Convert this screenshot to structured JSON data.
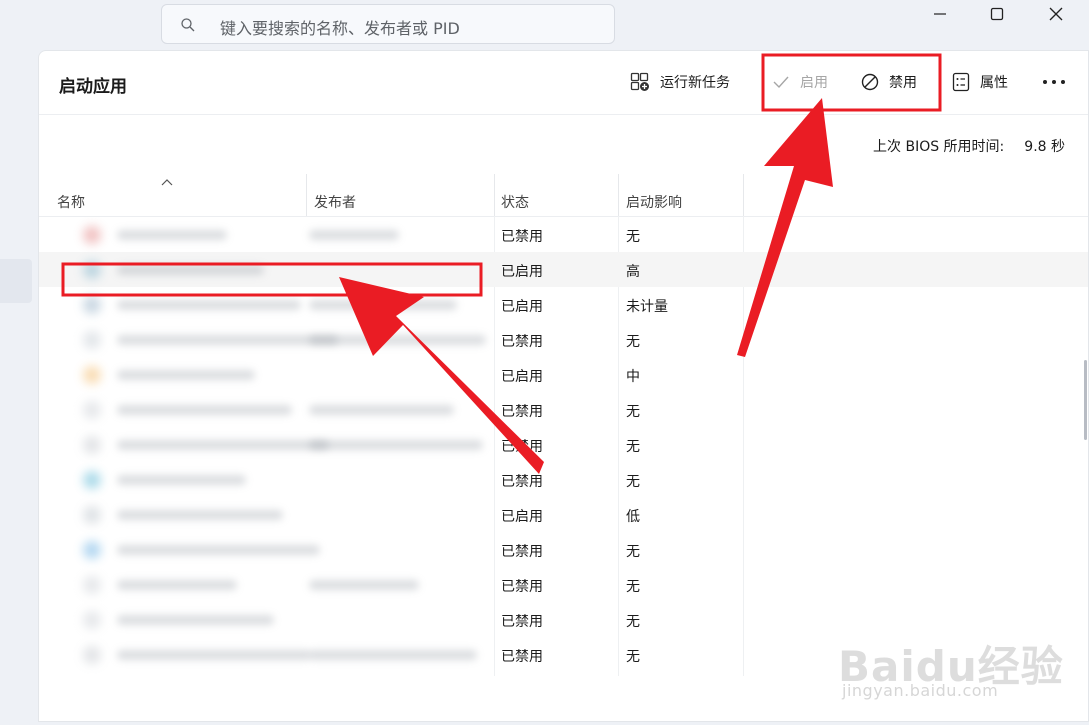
{
  "search": {
    "placeholder": "键入要搜索的名称、发布者或 PID"
  },
  "page": {
    "title": "启动应用"
  },
  "toolbar": {
    "run_new_task": "运行新任务",
    "enable": "启用",
    "disable": "禁用",
    "properties": "属性"
  },
  "bios": {
    "label": "上次 BIOS 所用时间:",
    "value": "9.8 秒"
  },
  "columns": {
    "name": "名称",
    "publisher": "发布者",
    "status": "状态",
    "impact": "启动影响"
  },
  "rows": [
    {
      "status": "已禁用",
      "impact": "无"
    },
    {
      "status": "已启用",
      "impact": "高"
    },
    {
      "status": "已启用",
      "impact": "未计量"
    },
    {
      "status": "已禁用",
      "impact": "无"
    },
    {
      "status": "已启用",
      "impact": "中"
    },
    {
      "status": "已禁用",
      "impact": "无"
    },
    {
      "status": "已禁用",
      "impact": "无"
    },
    {
      "status": "已禁用",
      "impact": "无"
    },
    {
      "status": "已启用",
      "impact": "低"
    },
    {
      "status": "已禁用",
      "impact": "无"
    },
    {
      "status": "已禁用",
      "impact": "无"
    },
    {
      "status": "已禁用",
      "impact": "无"
    },
    {
      "status": "已禁用",
      "impact": "无"
    }
  ],
  "watermark": {
    "logo": "Baidu经验",
    "url": "jingyan.baidu.com"
  },
  "colors": {
    "annotation_red": "#ea1c24",
    "accent": "#1b1b1b"
  }
}
